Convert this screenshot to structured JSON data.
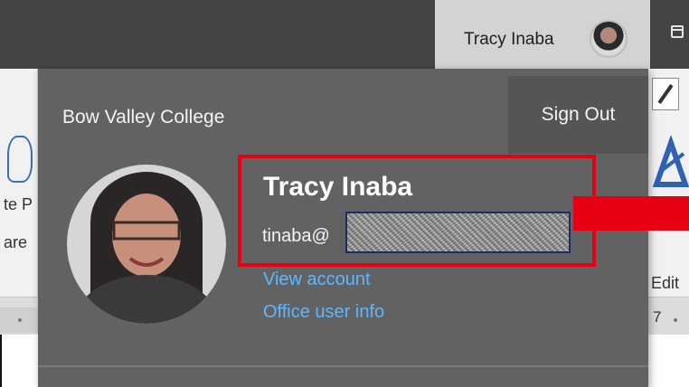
{
  "titlebar": {
    "user_name": "Tracy Inaba"
  },
  "ribbon": {
    "left_text_line1": "te P",
    "left_text_line2": "are",
    "edit_label": "Edit",
    "ruler_number": "7"
  },
  "account_popup": {
    "organization": "Bow Valley College",
    "sign_out_label": "Sign Out",
    "display_name": "Tracy Inaba",
    "email_prefix": "tinaba@",
    "view_account_label": "View account",
    "office_user_info_label": "Office user info"
  },
  "colors": {
    "titlebar_bg": "#444444",
    "popup_bg": "#626262",
    "link": "#5cb8ff",
    "highlight": "#e60012"
  },
  "icons": {
    "window": "restore-window-icon",
    "edit": "pencil-icon"
  }
}
